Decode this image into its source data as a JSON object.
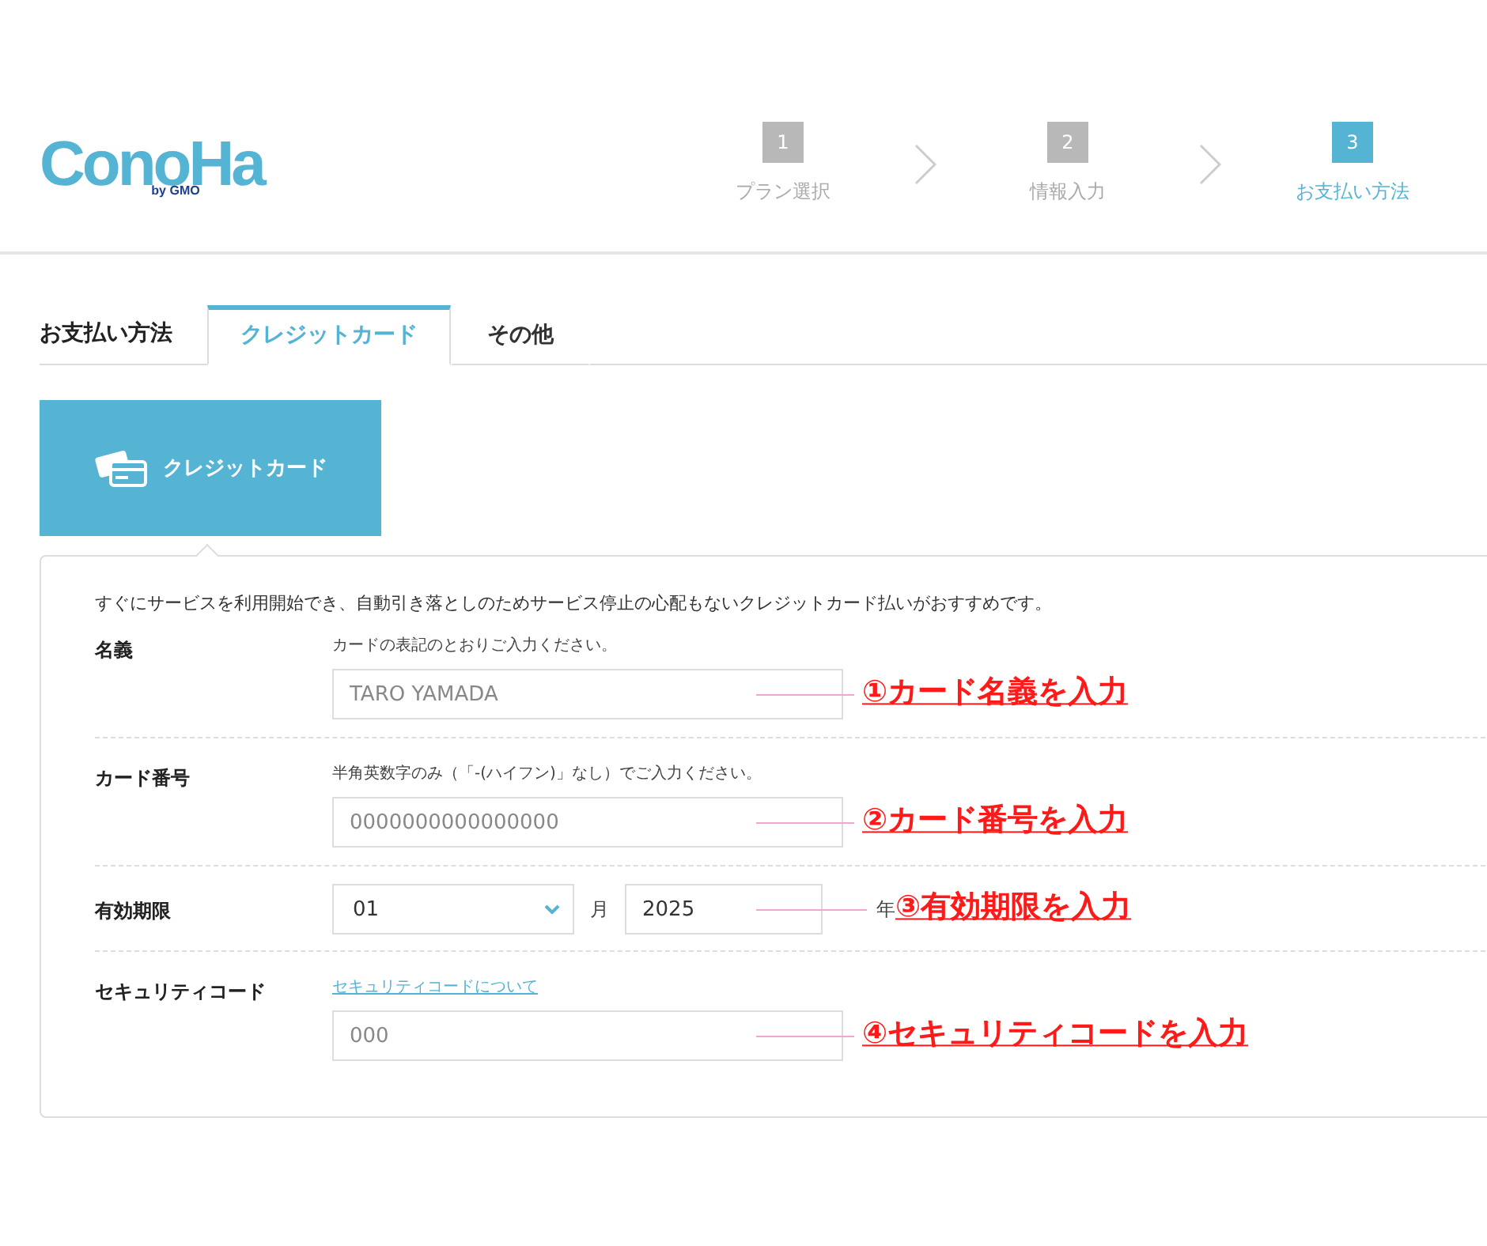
{
  "header": {
    "logo": {
      "name": "ConoHa",
      "tagline": "by GMO"
    },
    "steps": [
      {
        "number": "1",
        "label": "プラン選択",
        "selected": false
      },
      {
        "number": "2",
        "label": "情報入力",
        "selected": false
      },
      {
        "number": "3",
        "label": "お支払い方法",
        "selected": true
      }
    ]
  },
  "payment": {
    "heading": "お支払い方法",
    "tabs": [
      {
        "label": "クレジットカード",
        "selected": true
      },
      {
        "label": "その他",
        "selected": false
      }
    ],
    "method_tile": {
      "label": "クレジットカード"
    }
  },
  "form": {
    "description": "すぐにサービスを利用開始でき、自動引き落としのためサービス停止の心配もないクレジットカード払いがおすすめです。",
    "fields": [
      {
        "kind": "text",
        "label": "名義",
        "hint": "カードの表記のとおりご入力ください。",
        "placeholder": "TARO YAMADA",
        "annotation": "①カード名義を入力"
      },
      {
        "kind": "text",
        "label": "カード番号",
        "hint": "半角英数字のみ（「-(ハイフン)」なし）でご入力ください。",
        "placeholder": "0000000000000000",
        "annotation": "②カード番号を入力"
      },
      {
        "kind": "expiry",
        "label": "有効期限",
        "month": "01",
        "month_unit": "月",
        "year": "2025",
        "year_unit": "年",
        "annotation": "③有効期限を入力"
      },
      {
        "kind": "text",
        "label": "セキュリティコード",
        "link": "セキュリティコードについて",
        "placeholder": "000",
        "annotation": "④セキュリティコードを入力"
      }
    ]
  }
}
